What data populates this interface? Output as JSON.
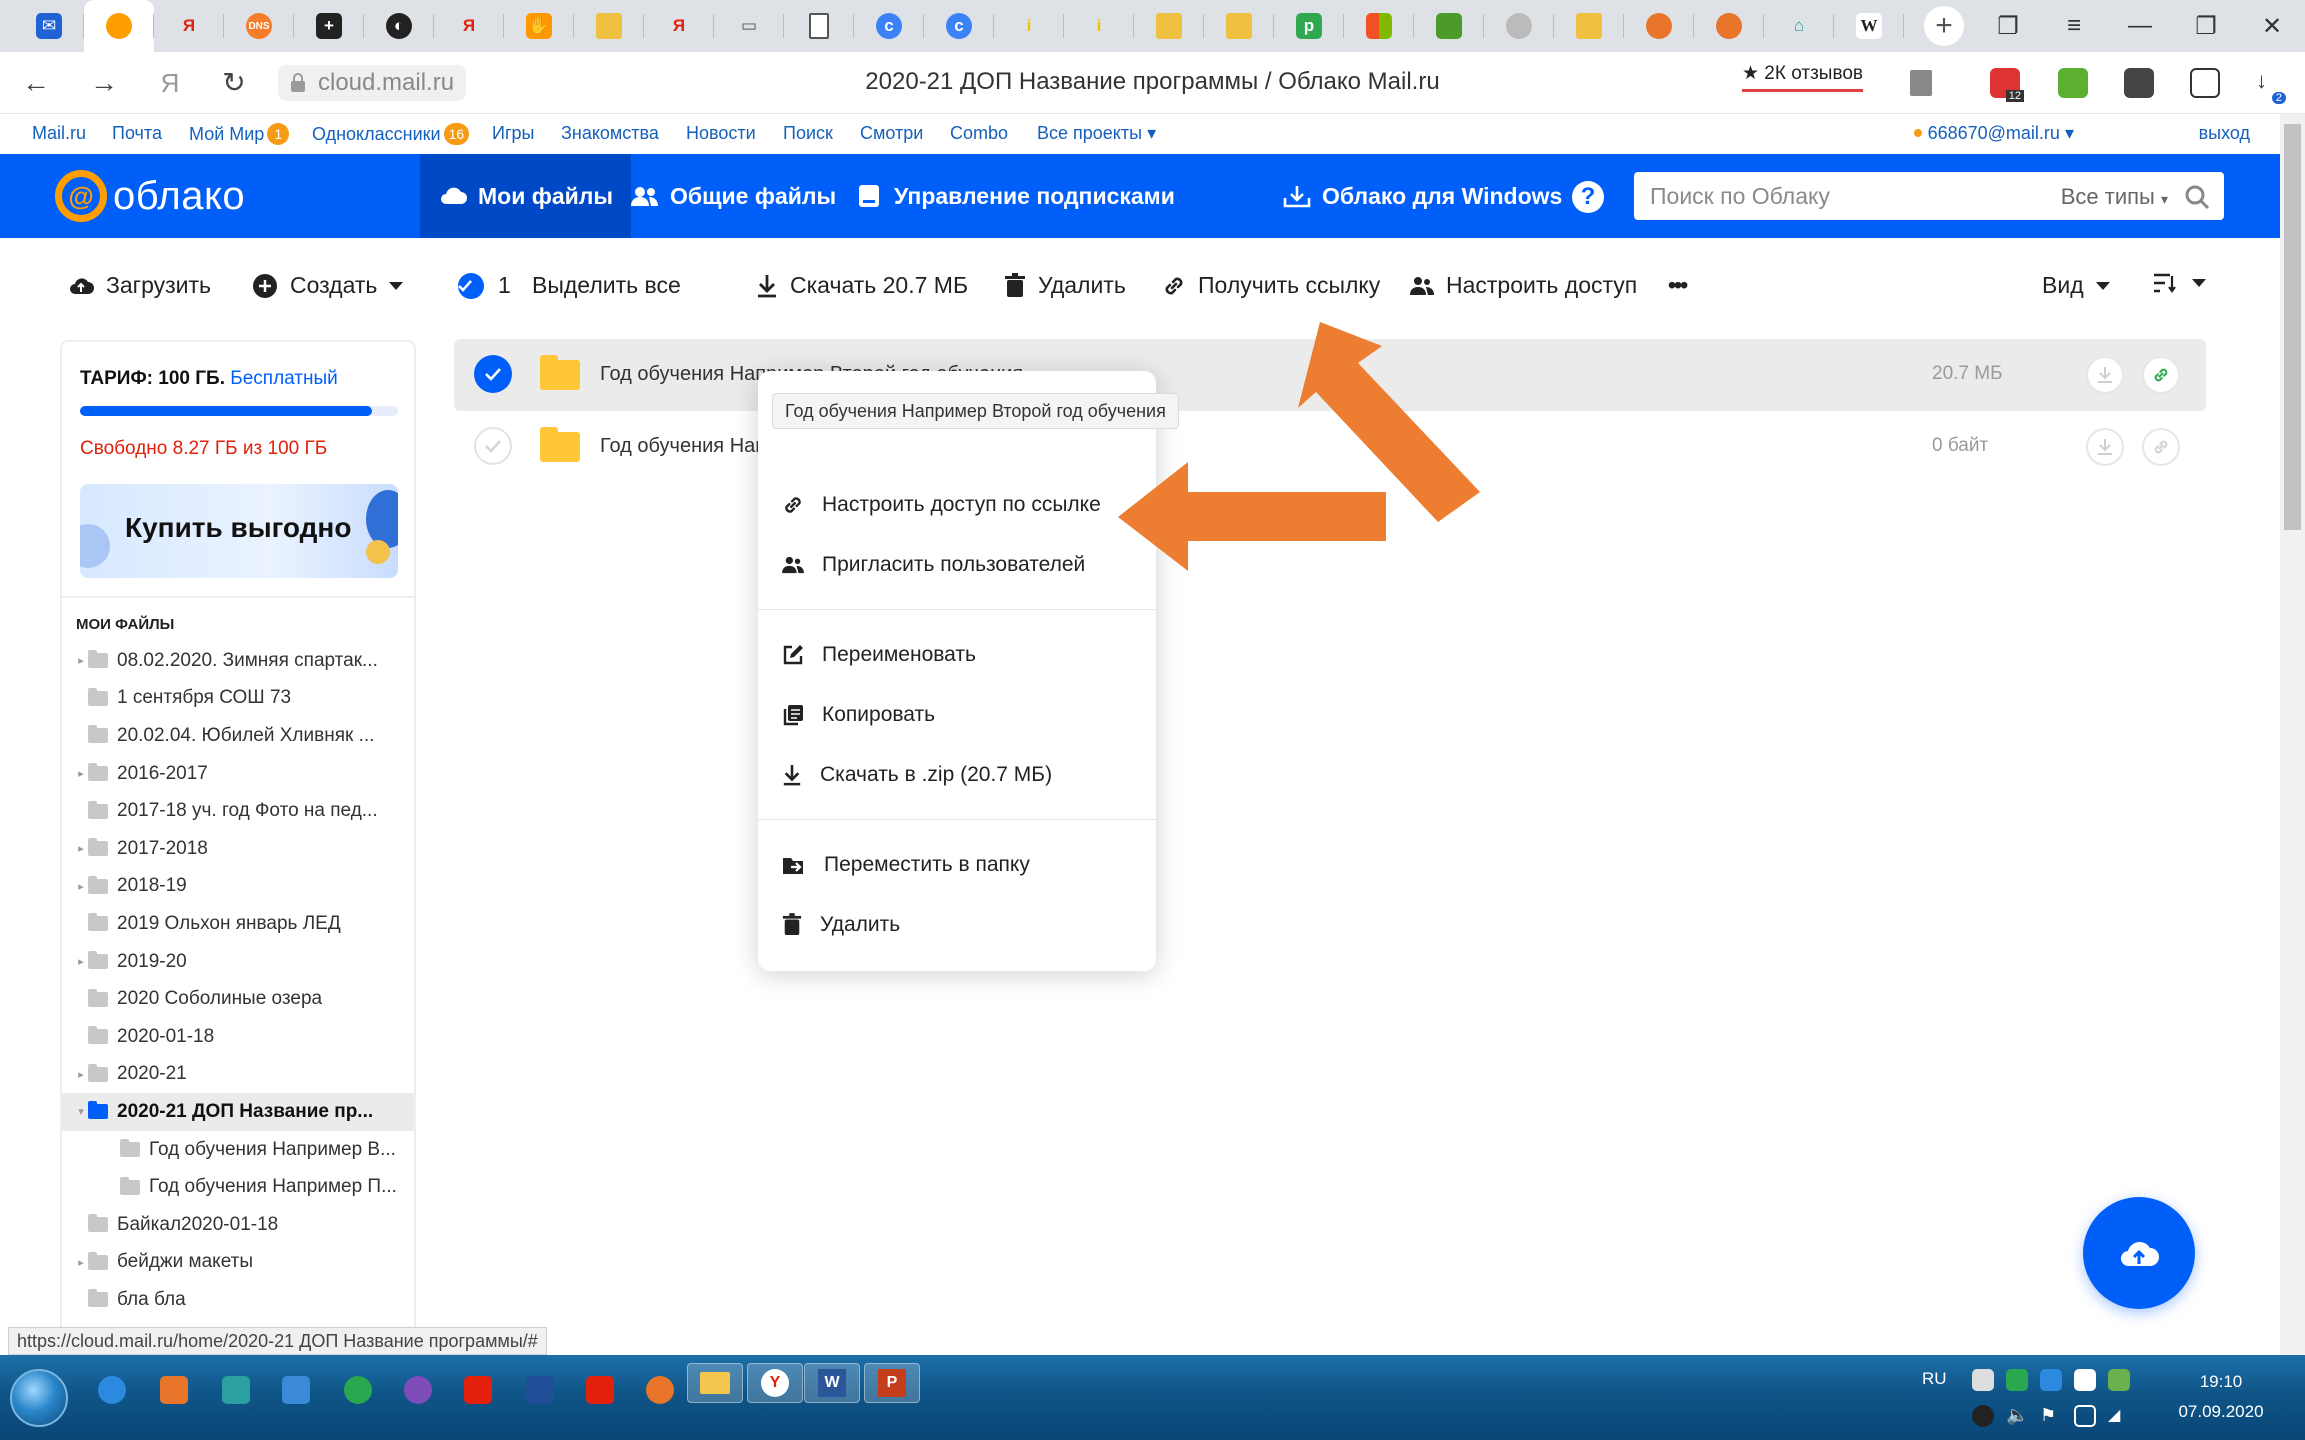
{
  "browser": {
    "page_title": "2020-21 ДОП Название программы / Облако Mail.ru",
    "url": "cloud.mail.ru",
    "reviews": "★ 2К отзывов",
    "ext_badge_1": "12",
    "ext_badge_2": "2"
  },
  "portal": {
    "links": [
      "Mail.ru",
      "Почта",
      "Мой Мир",
      "Одноклассники",
      "Игры",
      "Знакомства",
      "Новости",
      "Поиск",
      "Смотри",
      "Combo",
      "Все проекты"
    ],
    "moimir_badge": "1",
    "ok_badge": "16",
    "user": "668670@mail.ru",
    "logout": "выход"
  },
  "header": {
    "logo": "облако",
    "nav": [
      "Мои файлы",
      "Общие файлы",
      "Управление подписками"
    ],
    "windows": "Облако для Windows",
    "help": "?",
    "search_placeholder": "Поиск по Облаку",
    "types": "Все типы"
  },
  "toolbar": {
    "upload": "Загрузить",
    "create": "Создать",
    "selected_count": "1",
    "select_all": "Выделить все",
    "download": "Скачать 20.7 МБ",
    "delete": "Удалить",
    "get_link": "Получить ссылку",
    "access": "Настроить доступ",
    "more": "•••",
    "view": "Вид"
  },
  "sidebar": {
    "tariff": "ТАРИФ: 100 ГБ.",
    "plan": "Бесплатный",
    "free": "Свободно 8.27 ГБ из 100 ГБ",
    "used_fraction": 0.917,
    "promo": "Купить выгодно",
    "tree_title": "МОИ ФАЙЛЫ",
    "tree": [
      {
        "label": "08.02.2020. Зимняя спартак...",
        "expandable": true,
        "indent": 0
      },
      {
        "label": "1 сентября СОШ 73",
        "expandable": false,
        "indent": 0
      },
      {
        "label": "20.02.04. Юбилей Хливняк ...",
        "expandable": false,
        "indent": 0
      },
      {
        "label": "2016-2017",
        "expandable": true,
        "indent": 0
      },
      {
        "label": "2017-18 уч. год Фото на пед...",
        "expandable": false,
        "indent": 0
      },
      {
        "label": "2017-2018",
        "expandable": true,
        "indent": 0
      },
      {
        "label": "2018-19",
        "expandable": true,
        "indent": 0
      },
      {
        "label": "2019 Ольхон январь ЛЕД",
        "expandable": false,
        "indent": 0
      },
      {
        "label": "2019-20",
        "expandable": true,
        "indent": 0
      },
      {
        "label": "2020 Соболиные озера",
        "expandable": false,
        "indent": 0
      },
      {
        "label": "2020-01-18",
        "expandable": false,
        "indent": 0
      },
      {
        "label": "2020-21",
        "expandable": true,
        "indent": 0
      },
      {
        "label": "2020-21 ДОП Название пр...",
        "expandable": true,
        "indent": 0,
        "selected": true
      },
      {
        "label": "Год обучения Например В...",
        "expandable": false,
        "indent": 1
      },
      {
        "label": "Год обучения Например П...",
        "expandable": false,
        "indent": 1
      },
      {
        "label": "Байкал2020-01-18",
        "expandable": false,
        "indent": 0
      },
      {
        "label": "бейджи макеты",
        "expandable": true,
        "indent": 0
      },
      {
        "label": "бла бла",
        "expandable": false,
        "indent": 0
      }
    ]
  },
  "files": [
    {
      "name": "Год обучения Например Второй год обучения",
      "size": "20.7 МБ",
      "selected": true
    },
    {
      "name": "Год обучения Например Первый год обучения",
      "size": "0 байт",
      "selected": false
    }
  ],
  "context_menu": {
    "tooltip": "Год обучения Например Второй год обучения",
    "items": [
      "Настроить доступ по ссылке",
      "Пригласить пользователей",
      "Переименовать",
      "Копировать",
      "Скачать в .zip (20.7 МБ)",
      "Переместить в папку",
      "Удалить"
    ]
  },
  "status_url": "https://cloud.mail.ru/home/2020-21 ДОП Название программы/#",
  "taskbar": {
    "lang": "RU",
    "time": "19:10",
    "date": "07.09.2020"
  },
  "colors": {
    "brand_blue": "#005ff9",
    "arrow_orange": "#ed7d31",
    "folder_yellow": "#ffc637",
    "logo_orange": "#ff9e00"
  }
}
